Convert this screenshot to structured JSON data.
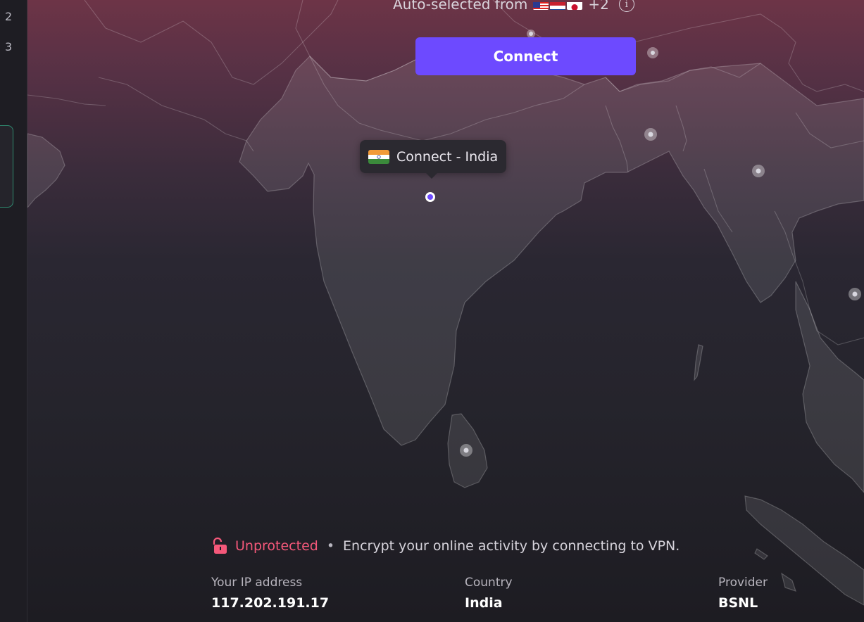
{
  "sidebar": {
    "numbers": [
      "2",
      "3"
    ]
  },
  "header": {
    "auto_selected_label": "Auto-selected from",
    "flag_icons": [
      "us-flag",
      "nl-flag",
      "jp-flag"
    ],
    "extra_count": "+2",
    "info_glyph": "i"
  },
  "connect_button": {
    "label": "Connect",
    "color": "#6d4aff"
  },
  "map_tooltip": {
    "label": "Connect - India",
    "flag_icon": "india-flag"
  },
  "status": {
    "label": "Unprotected",
    "separator": "•",
    "message": "Encrypt your online activity by connecting to VPN.",
    "color": "#f5587a",
    "icon": "unlocked-padlock-icon"
  },
  "connection_info": {
    "ip_label": "Your IP address",
    "ip_value": "117.202.191.17",
    "country_label": "Country",
    "country_value": "India",
    "provider_label": "Provider",
    "provider_value": "BSNL"
  }
}
